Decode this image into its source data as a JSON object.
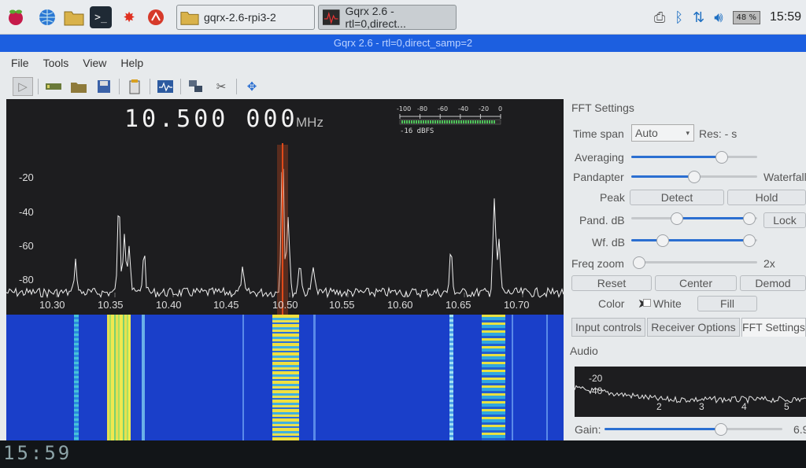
{
  "taskbar": {
    "icons": [
      "raspberry-icon",
      "globe-icon",
      "folder-icon",
      "terminal-icon",
      "burst-icon",
      "wolfram-icon"
    ],
    "tasks": [
      {
        "label": "gqrx-2.6-rpi3-2",
        "icon": "folder-icon"
      },
      {
        "label": "Gqrx 2.6 - rtl=0,direct...",
        "icon": "scope-icon"
      }
    ],
    "battery": "48 %",
    "clock": "15:59"
  },
  "window": {
    "title": "Gqrx 2.6 - rtl=0,direct_samp=2"
  },
  "menu": {
    "items": [
      "File",
      "Tools",
      "View",
      "Help"
    ]
  },
  "toolbar": {
    "buttons": [
      "play-icon",
      "device-icon",
      "open-folder-icon",
      "save-icon",
      "remote-icon",
      "scope-icon",
      "network-icon",
      "scissors-icon",
      "center-arrows-icon"
    ]
  },
  "spectrum": {
    "frequency": "10.500 000",
    "unit": "MHz",
    "meter_ticks": [
      "-100",
      "-80",
      "-60",
      "-40",
      "-20",
      "0"
    ],
    "meter_readout": "-16 dBFS",
    "y_ticks": [
      "-20",
      "-40",
      "-60",
      "-80"
    ],
    "x_ticks": [
      "10.30",
      "10.35",
      "10.40",
      "10.45",
      "10.50",
      "10.55",
      "10.60",
      "10.65",
      "10.70"
    ]
  },
  "panel": {
    "title": "FFT Settings",
    "time_span_label": "Time span",
    "time_span_value": "Auto",
    "res_label": "Res: - s",
    "averaging_label": "Averaging",
    "pandapter_label": "Pandapter",
    "waterfall_label": "Waterfall",
    "peak_label": "Peak",
    "detect_label": "Detect",
    "hold_label": "Hold",
    "pand_db_label": "Pand. dB",
    "lock_label": "Lock",
    "wf_db_label": "Wf. dB",
    "freq_zoom_label": "Freq zoom",
    "zoom_value": "2x",
    "reset_label": "Reset",
    "center_label": "Center",
    "demod_label": "Demod",
    "color_label": "Color",
    "white_label": "White",
    "fill_label": "Fill",
    "tabs": [
      "Input controls",
      "Receiver Options",
      "FFT Settings"
    ],
    "audio_label": "Audio",
    "audio_y_ticks": [
      "-20",
      "-40"
    ],
    "audio_x_ticks": [
      "2",
      "3",
      "4",
      "5"
    ],
    "gain_label": "Gain:",
    "gain_value": "6.9",
    "averaging_level": 0.72,
    "pandapter_level": 0.5
  },
  "bottom": {
    "clock": "15:59"
  },
  "colors": {
    "title_bar": "#1c5fe0",
    "waterfall_bg": "#1a3fc9",
    "trace": "#f0f0f0",
    "accent": "#2b6fd1"
  }
}
